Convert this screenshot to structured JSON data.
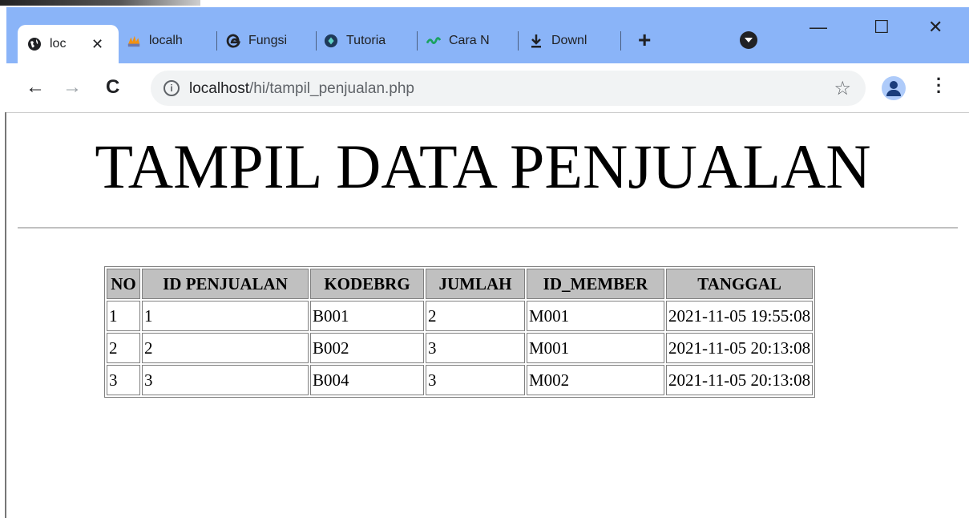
{
  "browser": {
    "tabs": [
      {
        "label": "loc",
        "icon": "globe-icon",
        "active": true
      },
      {
        "label": "localh",
        "icon": "phpmyadmin-icon"
      },
      {
        "label": "Fungsi",
        "icon": "edge-icon"
      },
      {
        "label": "Tutoria",
        "icon": "shield-icon"
      },
      {
        "label": "Cara N",
        "icon": "wave-icon"
      },
      {
        "label": "Downl",
        "icon": "download-icon"
      }
    ],
    "url_host": "localhost",
    "url_path": "/hi/tampil_penjualan.php"
  },
  "page": {
    "title": "TAMPIL DATA PENJUALAN",
    "table": {
      "headers": [
        "NO",
        "ID PENJUALAN",
        "KODEBRG",
        "JUMLAH",
        "ID_MEMBER",
        "TANGGAL"
      ],
      "rows": [
        [
          "1",
          "1",
          "B001",
          "2",
          "M001",
          "2021-11-05 19:55:08"
        ],
        [
          "2",
          "2",
          "B002",
          "3",
          "M001",
          "2021-11-05 20:13:08"
        ],
        [
          "3",
          "3",
          "B004",
          "3",
          "M002",
          "2021-11-05 20:13:08"
        ]
      ]
    }
  }
}
